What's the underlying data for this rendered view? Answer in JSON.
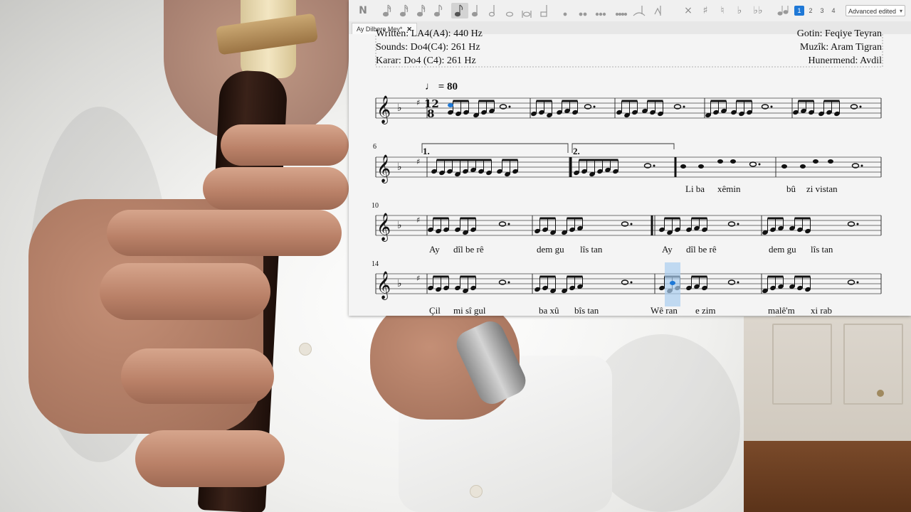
{
  "toolbar": {
    "note_input_icon": "N",
    "accidentals": [
      "×",
      "♯",
      "♮",
      "♭",
      "♭♭"
    ],
    "voices": [
      "1",
      "2",
      "3",
      "4"
    ],
    "workspace_select": "Advanced edited",
    "workspace_arrow": "▾"
  },
  "tabs": [
    {
      "label": "Ay Dilbere Mey*",
      "close": "✕"
    }
  ],
  "score": {
    "header_left": [
      "Written: LA4(A4): 440 Hz",
      "Sounds: Do4(C4): 261 Hz",
      "Karar: Do4 (C4): 261 Hz"
    ],
    "header_right": [
      "Gotin: Feqiye Teyran",
      "Muzîk: Aram Tigran",
      "Hunermend: Avdil"
    ],
    "tempo": "♩ = 80",
    "time_signature": [
      "12",
      "8"
    ],
    "measure_numbers": [
      "6",
      "10",
      "14"
    ],
    "voltas": [
      "1.",
      "2."
    ],
    "lyrics": {
      "system2": [
        "Li ba",
        "xêmin",
        "bû",
        "zi vistan"
      ],
      "system3": [
        "Ay",
        "dîl be rê",
        "dem gu",
        "lîs tan",
        "Ay",
        "dîl be rê",
        "dem gu",
        "lîs tan"
      ],
      "system4": [
        "Çil",
        "mi sî gul",
        "ba xû",
        "bîs tan",
        "Wê ran",
        "e zim",
        "malê'm",
        "xi rab"
      ]
    }
  },
  "colors": {
    "selection": "#1e78d6",
    "highlight": "#a9cdf0"
  }
}
